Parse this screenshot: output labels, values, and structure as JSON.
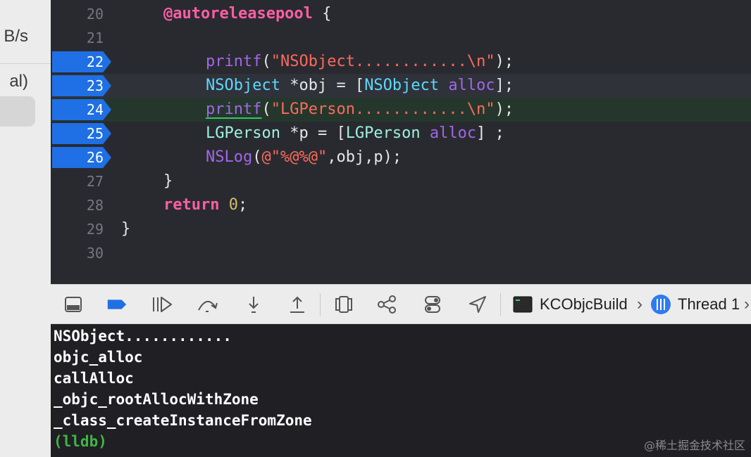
{
  "sidebar": {
    "rows": [
      "B/s",
      "al)"
    ]
  },
  "editor": {
    "lines": [
      {
        "num": "20"
      },
      {
        "num": "21"
      },
      {
        "num": "22"
      },
      {
        "num": "23"
      },
      {
        "num": "24"
      },
      {
        "num": "25"
      },
      {
        "num": "26"
      },
      {
        "num": "27"
      },
      {
        "num": "28"
      },
      {
        "num": "29"
      },
      {
        "num": "30"
      }
    ],
    "code": {
      "l20_kw": "@autoreleasepool",
      "l20_rest": " {",
      "l22_fn": "printf",
      "l22_open": "(",
      "l22_str": "\"NSObject............\\n\"",
      "l22_close": ");",
      "l23_type": "NSObject",
      "l23_mid": " *obj = [",
      "l23_type2": "NSObject",
      "l23_sp": " ",
      "l23_method": "alloc",
      "l23_end": "];",
      "l24_fn": "printf",
      "l24_open": "(",
      "l24_str": "\"LGPerson............\\n\"",
      "l24_close": ");",
      "l25_cls": "LGPerson",
      "l25_mid": " *p = [",
      "l25_cls2": "LGPerson",
      "l25_sp": " ",
      "l25_method": "alloc",
      "l25_end": "] ;",
      "l26_fn": "NSLog",
      "l26_open": "(",
      "l26_str": "@\"%@%@\"",
      "l26_end": ",obj,p);",
      "l27": "}",
      "l28_kw": "return",
      "l28_sp": " ",
      "l28_num": "0",
      "l28_end": ";",
      "l29": "}"
    },
    "breakpoint_lines": [
      "22",
      "23",
      "24",
      "25",
      "26"
    ]
  },
  "toolbar": {
    "icons": [
      "console-toggle-icon",
      "breakpoints-toggle-icon",
      "continue-icon",
      "step-over-icon",
      "step-into-icon",
      "step-out-icon",
      "view-hierarchy-icon",
      "memory-graph-icon",
      "environment-overrides-icon",
      "simulate-location-icon"
    ],
    "target_label": "KCObjcBuild",
    "thread_label": "Thread 1"
  },
  "console": {
    "lines": [
      "NSObject............",
      "objc_alloc",
      "callAlloc",
      "_objc_rootAllocWithZone",
      "_class_createInstanceFromZone"
    ],
    "prompt": "(lldb)"
  },
  "watermark": "@稀土掘金技术社区",
  "colors": {
    "breakpoint": "#1f6fe5",
    "keyword": "#fc5fa3",
    "string": "#fc6a5d",
    "function": "#a167e6",
    "type": "#5dd8ff",
    "class": "#9ef1dd",
    "number": "#d0bf69",
    "prompt": "#41b445"
  }
}
